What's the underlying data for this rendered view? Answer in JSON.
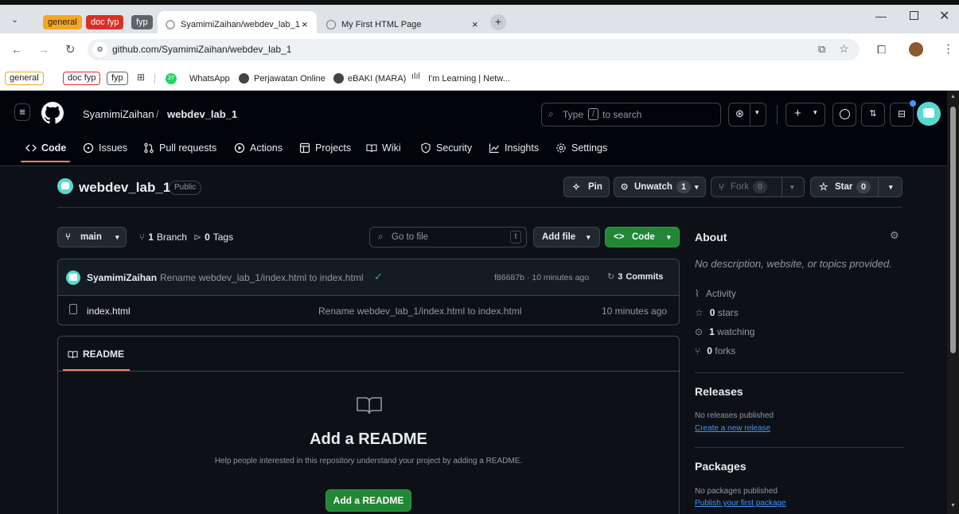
{
  "browser": {
    "tab_groups": [
      {
        "label": "general",
        "bg": "#f5a623",
        "fg": "#1f1f1f"
      },
      {
        "label": "doc fyp",
        "bg": "#d93025",
        "fg": "#ffffff"
      },
      {
        "label": "fyp",
        "bg": "#5f6368",
        "fg": "#ffffff"
      }
    ],
    "tabs": [
      {
        "title": "SyamimiZaihan/webdev_lab_1",
        "close": "×",
        "active": true
      },
      {
        "title": "My First HTML Page",
        "close": "×",
        "active": false
      }
    ],
    "new_tab": "+",
    "url": "github.com/SyamimiZaihan/webdev_lab_1",
    "bookmarks": {
      "chips": [
        "general",
        "doc fyp",
        "fyp"
      ],
      "items": [
        "WhatsApp",
        "Perjawatan Online",
        "eBAKI (MARA)",
        "I'm Learning | Netw..."
      ],
      "whatsapp_badge": "27"
    }
  },
  "header": {
    "owner": "SyamimiZaihan",
    "separator": "/",
    "repo": "webdev_lab_1",
    "search_prefix": "Type",
    "search_key": "/",
    "search_suffix": "to search",
    "plus": "+",
    "nav": [
      {
        "label": "Code",
        "icon": "code-icon"
      },
      {
        "label": "Issues",
        "icon": "issue-icon"
      },
      {
        "label": "Pull requests",
        "icon": "pull-request-icon"
      },
      {
        "label": "Actions",
        "icon": "play-icon"
      },
      {
        "label": "Projects",
        "icon": "table-icon"
      },
      {
        "label": "Wiki",
        "icon": "book-icon"
      },
      {
        "label": "Security",
        "icon": "shield-icon"
      },
      {
        "label": "Insights",
        "icon": "graph-icon"
      },
      {
        "label": "Settings",
        "icon": "gear-icon"
      }
    ]
  },
  "repo": {
    "name": "webdev_lab_1",
    "visibility": "Public",
    "pin": "Pin",
    "unwatch": "Unwatch",
    "watch_count": "1",
    "fork": "Fork",
    "fork_count": "0",
    "star": "Star",
    "star_count": "0"
  },
  "files": {
    "branch": "main",
    "branches_count": "1",
    "branches_label": "Branch",
    "tags_count": "0",
    "tags_label": "Tags",
    "go_to_file": "Go to file",
    "go_to_file_key": "t",
    "add_file": "Add file",
    "code_button": "Code",
    "commit_author": "SyamimiZaihan",
    "commit_message": "Rename webdev_lab_1/index.html to index.html",
    "commit_meta": "f86687b · 10 minutes ago",
    "commits_count": "3",
    "commits_label": "Commits",
    "rows": [
      {
        "name": "index.html",
        "message": "Rename webdev_lab_1/index.html to index.html",
        "time": "10 minutes ago"
      }
    ]
  },
  "readme": {
    "tab": "README",
    "heading": "Add a README",
    "description": "Help people interested in this repository understand your project by adding a README.",
    "button": "Add a README"
  },
  "about": {
    "title": "About",
    "description": "No description, website, or topics provided.",
    "activity": "Activity",
    "stars_count": "0",
    "stars_label": "stars",
    "watching_count": "1",
    "watching_label": "watching",
    "forks_count": "0",
    "forks_label": "forks",
    "releases_title": "Releases",
    "releases_text": "No releases published",
    "releases_link": "Create a new release",
    "packages_title": "Packages",
    "packages_text": "No packages published",
    "packages_link": "Publish your first package"
  },
  "colors": {
    "accent_green": "#238636",
    "link_blue": "#4493f8",
    "nav_underline": "#f78166",
    "bg": "#0d1117"
  }
}
